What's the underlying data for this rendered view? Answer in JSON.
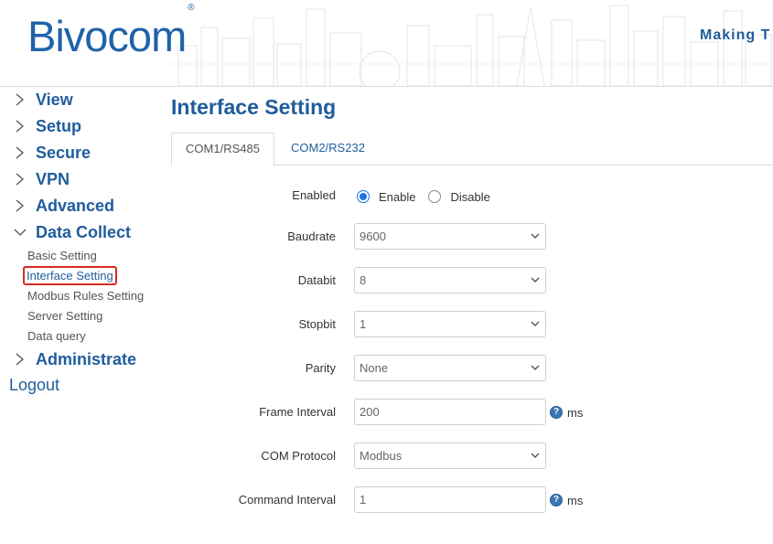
{
  "header": {
    "logo_text": "Bivocom",
    "logo_mark": "®",
    "tagline": "Making T"
  },
  "sidebar": {
    "items": [
      {
        "label": "View",
        "icon": "chevron-right-icon"
      },
      {
        "label": "Setup",
        "icon": "chevron-right-icon"
      },
      {
        "label": "Secure",
        "icon": "chevron-right-icon"
      },
      {
        "label": "VPN",
        "icon": "chevron-right-icon"
      },
      {
        "label": "Advanced",
        "icon": "chevron-right-icon"
      },
      {
        "label": "Data Collect",
        "icon": "chevron-down-icon",
        "expanded": true
      },
      {
        "label": "Administrate",
        "icon": "chevron-right-icon"
      }
    ],
    "subitems": [
      {
        "label": "Basic Setting"
      },
      {
        "label": "Interface Setting",
        "active": true
      },
      {
        "label": "Modbus Rules Setting"
      },
      {
        "label": "Server Setting"
      },
      {
        "label": "Data query"
      }
    ],
    "logout": "Logout"
  },
  "main": {
    "title": "Interface Setting",
    "tabs": [
      {
        "label": "COM1/RS485",
        "active": true
      },
      {
        "label": "COM2/RS232",
        "active": false
      }
    ],
    "form": {
      "enabled": {
        "label": "Enabled",
        "options": [
          "Enable",
          "Disable"
        ],
        "selected": "Enable"
      },
      "baudrate": {
        "label": "Baudrate",
        "value": "9600"
      },
      "databit": {
        "label": "Databit",
        "value": "8"
      },
      "stopbit": {
        "label": "Stopbit",
        "value": "1"
      },
      "parity": {
        "label": "Parity",
        "value": "None"
      },
      "frame_interval": {
        "label": "Frame Interval",
        "value": "200",
        "unit": "ms"
      },
      "com_protocol": {
        "label": "COM Protocol",
        "value": "Modbus"
      },
      "command_interval": {
        "label": "Command Interval",
        "value": "1",
        "unit": "ms"
      }
    }
  },
  "colors": {
    "brand": "#1f5d9c",
    "logo": "#1f63a8",
    "highlight": "#d62d20",
    "radio": "#1a73e8"
  }
}
